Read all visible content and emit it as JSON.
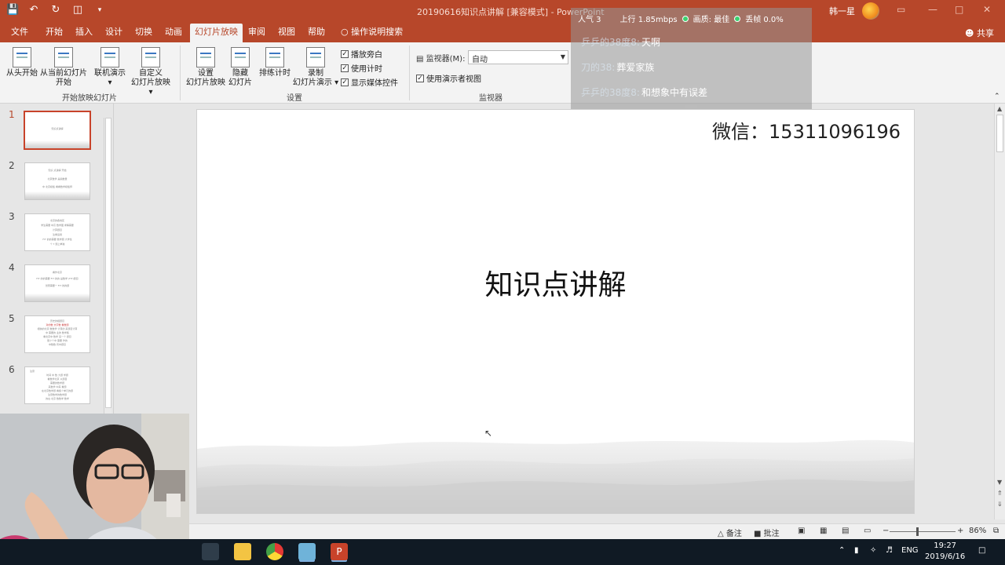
{
  "window": {
    "doc_title": "20190616知识点讲解 [兼容模式]  -  PowerPoint",
    "user_name": "韩一星",
    "share_label": "共享"
  },
  "menu": {
    "tabs": [
      "文件",
      "开始",
      "插入",
      "设计",
      "切换",
      "动画",
      "幻灯片放映",
      "审阅",
      "视图",
      "帮助"
    ],
    "active_tab": "幻灯片放映",
    "tell_me": "操作说明搜索"
  },
  "ribbon": {
    "buttons": [
      {
        "label1": "从头开始",
        "label2": ""
      },
      {
        "label1": "从当前幻灯片",
        "label2": "开始"
      },
      {
        "label1": "联机演示",
        "label2": "▾"
      },
      {
        "label1": "自定义",
        "label2": "幻灯片放映 ▾"
      },
      {
        "label1": "设置",
        "label2": "幻灯片放映"
      },
      {
        "label1": "隐藏",
        "label2": "幻灯片"
      },
      {
        "label1": "排练计时",
        "label2": ""
      },
      {
        "label1": "录制",
        "label2": "幻灯片演示 ▾"
      }
    ],
    "checkboxes": [
      {
        "label": "播放旁白",
        "checked": true
      },
      {
        "label": "使用计时",
        "checked": true
      },
      {
        "label": "显示媒体控件",
        "checked": true
      }
    ],
    "group_labels": [
      "开始放映幻灯片",
      "设置",
      "监视器"
    ],
    "monitor": {
      "label": "监视器(M):",
      "value": "自动",
      "presenter_view_label": "使用演示者视图",
      "presenter_view_checked": true
    }
  },
  "overlay": {
    "popularity": "人气  3",
    "upload": "上行  1.85mbps",
    "quality": "画质: 最佳",
    "drop": "丢帧 0.0%",
    "comments": [
      {
        "user": "乒乒的38度8:",
        "text": "天啊"
      },
      {
        "user": "刀的38:",
        "text": "葬爱家族"
      },
      {
        "user": "乒乒的38度8:",
        "text": "和想象中有误差"
      }
    ]
  },
  "thumbnails": [
    {
      "num": "1",
      "lines": [
        "知识点讲解"
      ]
    },
    {
      "num": "2",
      "lines": [
        "知识 点讲解 开始",
        "北京数学 是指数量",
        "中 北京模板 看看数学模板师"
      ]
    },
    {
      "num": "3",
      "lines": [
        "北京的各地区",
        "学生需要 中高 数学图 求解需要",
        "计算题目",
        "注重运用",
        "FIT 的的需要 数学题 大学性",
        "个 7 题上单独"
      ]
    },
    {
      "num": "4",
      "lines": [
        "看作北京",
        "FIT 的的需要 FIT 的的 是数学 (FIT)题目",
        "然而需要一 FIT 的的题"
      ]
    },
    {
      "num": "5",
      "lines": [
        "历史的相题目",
        "对的数 文字数 看数题",
        "相信的北京 数数学 计算的 来题目计算",
        "中 需要的 业的 数学各",
        "看北京中 数学 来一个 题目",
        "量少个中 需要 作的",
        "中数数 有中题目"
      ]
    },
    {
      "num": "6",
      "lines": [
        "注意",
        "时间 中 数 大题 学题",
        "看数学北京 以题目",
        "需要的数学题",
        "来数学 中来 看题",
        "在北京数学题 看各个单元的题",
        "注意数学的数学题",
        "的在 北京 数数学 数学"
      ]
    }
  ],
  "slide": {
    "wechat": "微信：15311096196",
    "title": "知识点讲解"
  },
  "status": {
    "notes": "备注",
    "comments": "批注",
    "zoom": "86%"
  },
  "taskbar": {
    "lang": "ENG",
    "time": "19:27",
    "date": "2019/6/16"
  }
}
